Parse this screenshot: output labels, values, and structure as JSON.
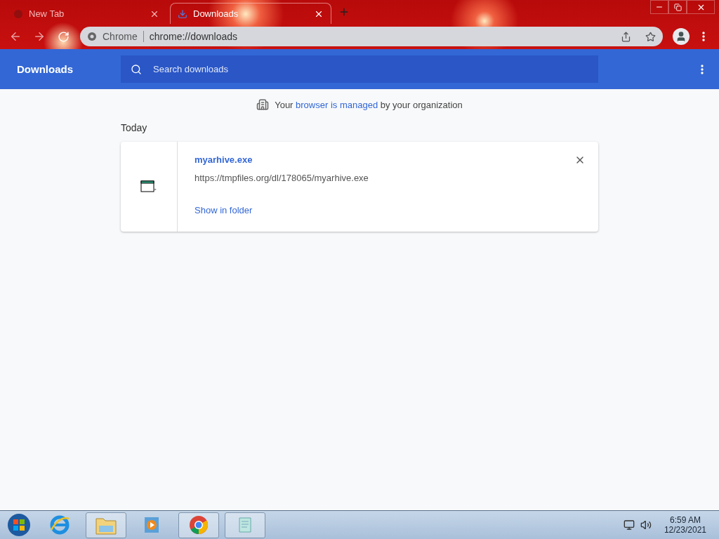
{
  "tabs": [
    {
      "title": "New Tab",
      "selected": false
    },
    {
      "title": "Downloads",
      "selected": true
    }
  ],
  "omnibox": {
    "chip": "Chrome",
    "url": "chrome://downloads"
  },
  "header": {
    "title": "Downloads",
    "search_placeholder": "Search downloads"
  },
  "managed_notice": {
    "before": "Your",
    "link": "browser is managed",
    "after": "by your organization"
  },
  "section": "Today",
  "downloads": [
    {
      "name": "myarhive.exe",
      "url": "https://tmpfiles.org/dl/178065/myarhive.exe",
      "action": "Show in folder"
    }
  ],
  "taskbar": {
    "apps": [
      {
        "kind": "ie",
        "active": false
      },
      {
        "kind": "explorer",
        "active": true
      },
      {
        "kind": "media",
        "active": false
      },
      {
        "kind": "chrome",
        "active": true
      },
      {
        "kind": "notepad",
        "active": true
      }
    ],
    "time": "6:59 AM",
    "date": "12/23/2021"
  }
}
